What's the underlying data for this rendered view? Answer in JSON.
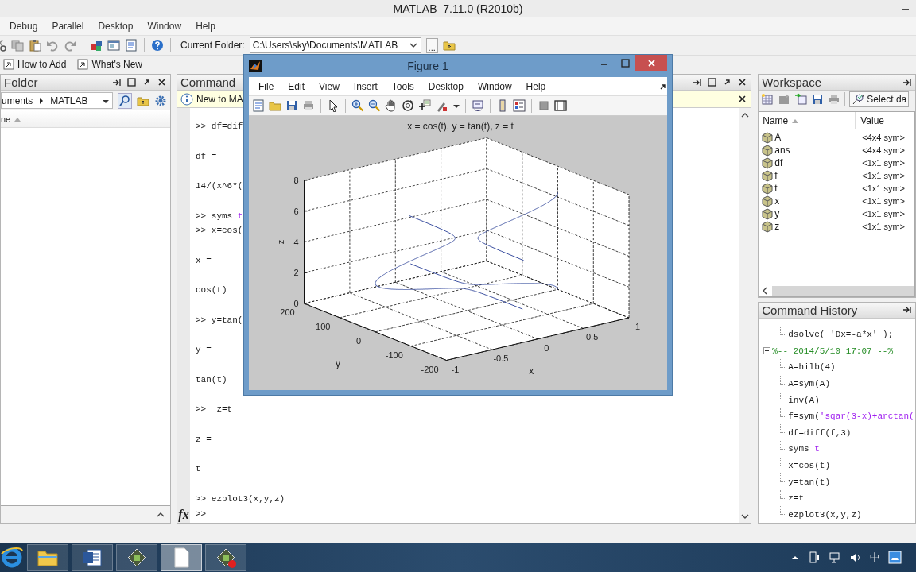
{
  "app": {
    "title": "MATLAB  7.11.0 (R2010b)"
  },
  "menu": [
    "Debug",
    "Parallel",
    "Desktop",
    "Window",
    "Help"
  ],
  "toolbar": {
    "folder_label": "Current Folder:",
    "folder_path": "C:\\Users\\sky\\Documents\\MATLAB",
    "browse": "..."
  },
  "shortcuts": [
    "How to Add",
    "What's New"
  ],
  "folder_pane": {
    "title": "Folder",
    "path": [
      "uments",
      "MATLAB"
    ],
    "column": "ne"
  },
  "command_window": {
    "title": "Command",
    "notice": "New to MA",
    "blocks": [
      [
        {
          "text": ">> df=dif"
        }
      ],
      [
        {
          "text": "df ="
        }
      ],
      [
        {
          "text": "14/(x^6*("
        }
      ],
      [
        {
          "text": ">> syms ",
          "arg": "t"
        },
        {
          "text": ">> x=cos("
        }
      ],
      [
        {
          "text": "x ="
        }
      ],
      [
        {
          "text": "cos(t)"
        }
      ],
      [
        {
          "text": ">> y=tan("
        }
      ],
      [
        {
          "text": "y ="
        }
      ],
      [
        {
          "text": "tan(t)"
        }
      ],
      [
        {
          "text": ">>  z=t"
        }
      ],
      [
        {
          "text": "z ="
        }
      ],
      [
        {
          "text": "t"
        }
      ],
      [
        {
          "text": ">> ezplot3(x,y,z)"
        }
      ]
    ],
    "prompt_icon": "fx",
    "prompt": ">>"
  },
  "workspace": {
    "title": "Workspace",
    "select_button": "Select da",
    "columns": [
      "Name",
      "Value"
    ],
    "rows": [
      {
        "name": "A",
        "value": "<4x4 sym>"
      },
      {
        "name": "ans",
        "value": "<4x4 sym>"
      },
      {
        "name": "df",
        "value": "<1x1 sym>"
      },
      {
        "name": "f",
        "value": "<1x1 sym>"
      },
      {
        "name": "t",
        "value": "<1x1 sym>"
      },
      {
        "name": "x",
        "value": "<1x1 sym>"
      },
      {
        "name": "y",
        "value": "<1x1 sym>"
      },
      {
        "name": "z",
        "value": "<1x1 sym>"
      }
    ]
  },
  "history": {
    "title": "Command History",
    "items": [
      {
        "text": "dsolve( 'Dx=-a*x' );"
      },
      {
        "text": "%-- 2014/5/10 17:07 --%",
        "expanded": true,
        "children": [
          {
            "text": "A=hilb(4)"
          },
          {
            "text": "A=sym(A)"
          },
          {
            "text": "inv(A)"
          },
          {
            "text": "f=sym(",
            "arg": "'sqar(3-x)+arctan("
          },
          {
            "text": "df=diff(f,3)"
          },
          {
            "text": "syms ",
            "arg": "t"
          },
          {
            "text": "x=cos(t)"
          },
          {
            "text": "y=tan(t)"
          },
          {
            "text": "z=t"
          },
          {
            "text": "ezplot3(x,y,z)"
          }
        ]
      }
    ]
  },
  "figure": {
    "title": "Figure 1",
    "menu": [
      "File",
      "Edit",
      "View",
      "Insert",
      "Tools",
      "Desktop",
      "Window",
      "Help"
    ],
    "plot": {
      "title": "x = cos(t), y = tan(t), z = t",
      "xlabel": "x",
      "ylabel": "y",
      "zlabel": "z",
      "xticks": [
        "-1",
        "-0.5",
        "0",
        "0.5",
        "1"
      ],
      "yticks": [
        "200",
        "100",
        "0",
        "-100",
        "-200"
      ],
      "zticks": [
        "8",
        "6",
        "4",
        "2",
        "0"
      ]
    }
  },
  "taskbar": {
    "apps": [
      {
        "kind": "browser",
        "selected": false
      },
      {
        "kind": "folder",
        "selected": false
      },
      {
        "kind": "word",
        "selected": false
      },
      {
        "kind": "matlab",
        "selected": false
      },
      {
        "kind": "document",
        "selected": true
      },
      {
        "kind": "matlab-record",
        "selected": false
      }
    ],
    "input_method": "中"
  }
}
